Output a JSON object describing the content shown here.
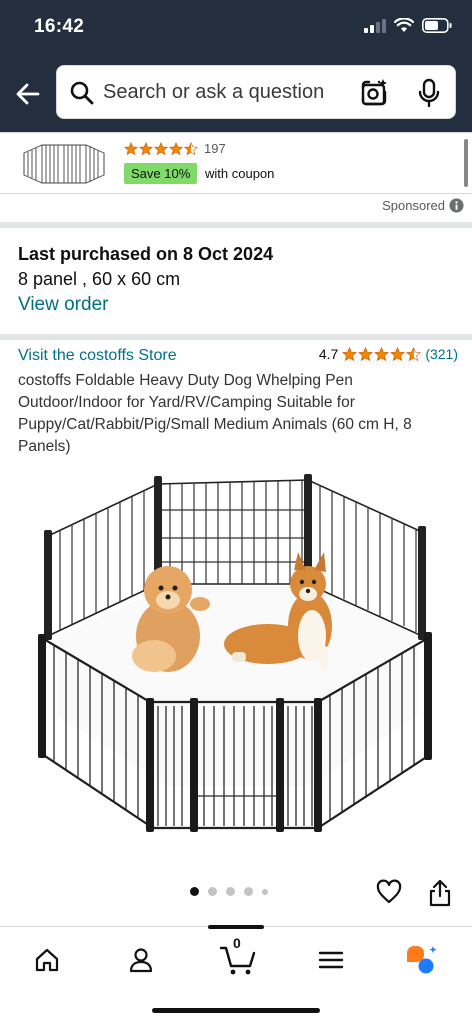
{
  "status": {
    "time": "16:42"
  },
  "search": {
    "placeholder": "Search or ask a question"
  },
  "ad": {
    "rating_count": "197",
    "badge": "Save 10%",
    "coupon_text": "with coupon",
    "sponsored_label": "Sponsored",
    "stars": 4.5
  },
  "purchase": {
    "title": "Last purchased on 8 Oct 2024",
    "variant": "8 panel , 60 x 60 cm",
    "view_order": "View order"
  },
  "product": {
    "store": "Visit the costoffs Store",
    "rating": "4.7",
    "stars": 4.5,
    "review_count": "(321)",
    "title": "costoffs Foldable Heavy Duty Dog Whelping Pen Outdoor/Indoor for Yard/RV/Camping Suitable for Puppy/Cat/Rabbit/Pig/Small Medium Animals (60 cm H, 8 Panels)",
    "image_count": 5,
    "active_image": 1
  },
  "tabbar": {
    "cart_count": "0",
    "items": [
      "home-icon",
      "account-icon",
      "cart-icon",
      "menu-icon",
      "rufus-icon"
    ]
  },
  "colors": {
    "header": "#232f3e",
    "link": "#007185",
    "star": "#f08804",
    "badge": "#7fda69"
  }
}
